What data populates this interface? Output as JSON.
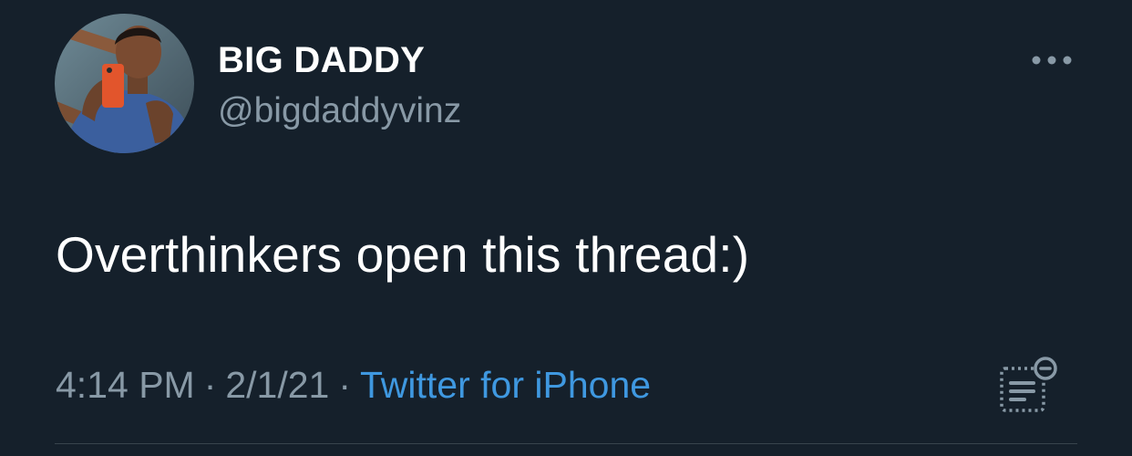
{
  "colors": {
    "background": "#15202b",
    "primary_text": "#ffffff",
    "secondary_text": "#8899a6",
    "accent": "#3f98e0",
    "divider": "#38444d"
  },
  "user": {
    "display_name": "BIG DADDY",
    "handle": "@bigdaddyvinz"
  },
  "tweet": {
    "text": "Overthinkers open this thread:)",
    "time": "4:14 PM",
    "separator": "·",
    "date": "2/1/21",
    "source": "Twitter for iPhone"
  },
  "icons": {
    "more": "more-horizontal-icon",
    "activity": "tweet-activity-icon"
  }
}
